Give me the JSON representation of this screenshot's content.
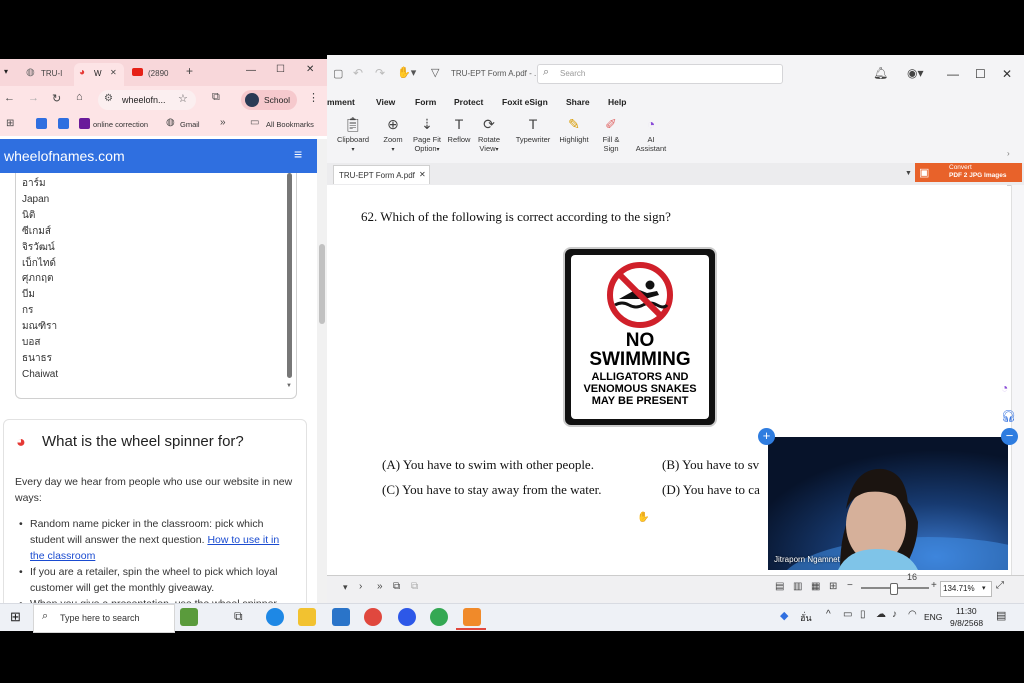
{
  "pdf": {
    "doc_title": "TRU-EPT Form A.pdf - ...",
    "search_placeholder": "Search",
    "menu": [
      "mment",
      "View",
      "Form",
      "Protect",
      "Foxit eSign",
      "Share",
      "Help"
    ],
    "ribbon": {
      "clipboard": "Clipboard",
      "zoom": "Zoom",
      "page_fit_1": "Page Fit",
      "page_fit_2": "Option",
      "reflow": "Reflow",
      "rotate_1": "Rotate",
      "rotate_2": "View",
      "typewriter": "Typewriter",
      "highlight": "Highlight",
      "fill_1": "Fill &",
      "fill_2": "Sign",
      "ai_1": "AI",
      "ai_2": "Assistant"
    },
    "convert_banner_1": "Convert",
    "convert_banner_2": "PDF 2 JPG Images",
    "tab_name": "TRU-EPT Form A.pdf",
    "question": "62. Which of the following is correct according to the sign?",
    "sign": {
      "line1": "NO",
      "line2": "SWIMMING",
      "line3": "ALLIGATORS AND",
      "line4": "VENOMOUS SNAKES",
      "line5": "MAY BE PRESENT"
    },
    "options": {
      "a": "(A) You have to swim with other people.",
      "b": "(B) You have to sv",
      "c": "(C) You have to stay away from the water.",
      "d": "(D) You have to ca"
    },
    "page_number_partial": "16",
    "zoom_value": "134.71%"
  },
  "chrome": {
    "tabs": [
      {
        "label": "TRU-I"
      },
      {
        "label": "W"
      },
      {
        "label": "(2890"
      }
    ],
    "address": "wheelofn...",
    "profile": "School",
    "bookmarks": {
      "online_correction": "online correction",
      "gmail": "Gmail",
      "all_bookmarks": "All Bookmarks"
    },
    "site_title": "wheelofnames.com",
    "names": [
      "อาร์ม",
      "Japan",
      "นิติ",
      "ซีเกมส์",
      "จิรวัฒน์",
      "เบ็กไทด์",
      "ศุภกฤต",
      "บีม",
      "กร",
      "มณฑิรา",
      "บอส",
      "ธนาธร",
      "Chaiwat"
    ],
    "faq_heading": "What is the wheel spinner for?",
    "faq_intro": "Every day we hear from people who use our website in new ways:",
    "faq_b1_text": "Random name picker in the classroom: pick which student will answer the next question. ",
    "faq_b1_link": "How to use it in the classroom",
    "faq_b2": "If you are a retailer, spin the wheel to pick which loyal customer will get the monthly giveaway.",
    "faq_b3": "When you give a presentation, use the wheel spinner"
  },
  "taskbar": {
    "search_placeholder": "Type here to search",
    "lang": "ENG",
    "ime": "ฮั่น",
    "time": "11:30",
    "date": "9/8/2568"
  },
  "video": {
    "participant": "Jitraporn Ngamnet"
  },
  "colors": {
    "chrome_tab": "#f8d7da",
    "site_header": "#2f6fe0",
    "convert_orange": "#e8622a",
    "sign_red": "#d0202a"
  }
}
